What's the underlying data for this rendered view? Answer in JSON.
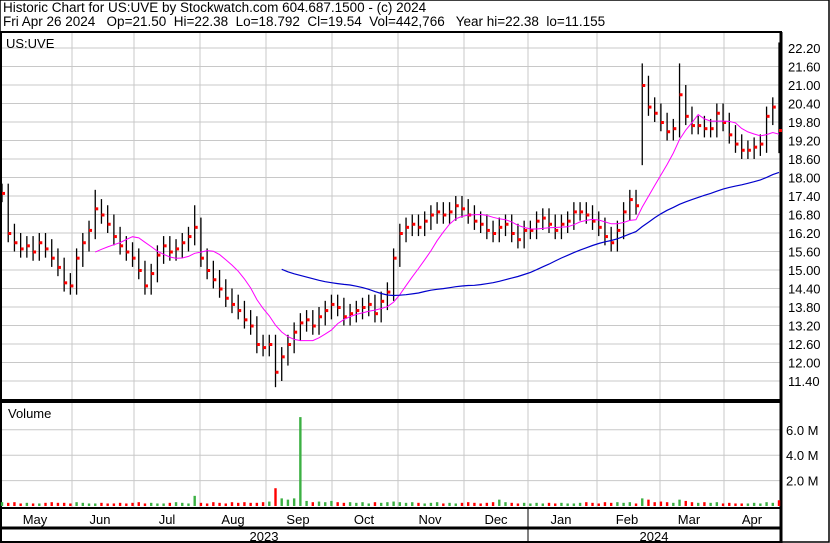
{
  "header": {
    "title": "Historic Chart for US:UVE by Stockwatch.com 604.687.1500 - (c) 2024",
    "quote": "Fri Apr 26 2024   Op=21.50  Hi=22.38  Lo=18.792  Cl=19.54  Vol=442,766   Year hi=22.38  lo=11.155"
  },
  "colors": {
    "up": "#3cb043",
    "down": "#ff0000",
    "bar": "#000000",
    "ma_short": "#ff00ff",
    "ma_long": "#0000cc",
    "grid": "#c8c8c8"
  },
  "chart_data": {
    "type": "line",
    "title": "US:UVE",
    "symbol_label": "US:UVE",
    "volume_label": "Volume",
    "price_ylim": [
      11.1,
      23.0
    ],
    "price_ticks": [
      "22.20",
      "21.60",
      "21.00",
      "20.40",
      "19.80",
      "19.20",
      "18.60",
      "18.00",
      "17.40",
      "16.80",
      "16.20",
      "15.60",
      "15.00",
      "14.40",
      "13.80",
      "13.20",
      "12.60",
      "12.00",
      "11.40"
    ],
    "volume_ticks": [
      {
        "v": 6,
        "label": "6.0 M"
      },
      {
        "v": 4,
        "label": "4.0 M"
      },
      {
        "v": 2,
        "label": "2.0 M"
      }
    ],
    "months": [
      "May",
      "Jun",
      "Jul",
      "Aug",
      "Sep",
      "Oct",
      "Nov",
      "Dec",
      "Jan",
      "Feb",
      "Mar",
      "Apr"
    ],
    "years": [
      "2023",
      "2024"
    ],
    "ma_short_period": 10,
    "ma_long_period": 45,
    "closes": [
      17.5,
      16.2,
      15.9,
      15.7,
      15.8,
      15.6,
      15.9,
      15.7,
      15.4,
      15.1,
      14.6,
      14.5,
      15.4,
      15.9,
      16.3,
      17.0,
      16.8,
      16.5,
      16.1,
      15.8,
      15.6,
      15.4,
      15.0,
      14.5,
      14.9,
      15.5,
      15.8,
      15.6,
      15.7,
      15.9,
      16.1,
      16.4,
      15.4,
      15.0,
      14.7,
      14.4,
      14.1,
      13.9,
      13.7,
      13.4,
      13.2,
      12.6,
      12.5,
      12.6,
      11.7,
      12.2,
      12.6,
      13.0,
      13.3,
      13.4,
      13.2,
      13.5,
      13.7,
      13.9,
      13.8,
      13.5,
      13.6,
      13.7,
      13.8,
      13.9,
      13.6,
      14.0,
      14.3,
      15.4,
      16.2,
      16.4,
      16.5,
      16.4,
      16.6,
      16.8,
      16.9,
      16.8,
      16.9,
      17.1,
      17.0,
      16.8,
      16.6,
      16.5,
      16.3,
      16.2,
      16.4,
      16.5,
      16.2,
      16.0,
      16.3,
      16.3,
      16.6,
      16.7,
      16.5,
      16.3,
      16.5,
      16.6,
      16.9,
      16.9,
      16.8,
      16.6,
      16.4,
      16.1,
      15.9,
      16.3,
      16.9,
      17.3,
      17.1,
      21.0,
      20.3,
      20.1,
      19.8,
      19.5,
      19.6,
      20.7,
      20.0,
      19.7,
      19.7,
      19.6,
      19.6,
      20.1,
      19.8,
      19.4,
      19.1,
      18.9,
      18.9,
      19.0,
      19.1,
      20.0,
      20.3,
      19.54
    ],
    "high_overrides": {
      "15": 17.6,
      "31": 17.1,
      "103": 21.7,
      "109": 21.7,
      "125": 22.38
    },
    "low_overrides": {
      "44": 11.2,
      "103": 18.4,
      "125": 18.79
    },
    "volumes_m": [
      0.3,
      0.25,
      0.3,
      0.2,
      0.25,
      0.2,
      0.2,
      0.25,
      0.3,
      0.25,
      0.25,
      0.2,
      0.3,
      0.25,
      0.2,
      0.2,
      0.25,
      0.2,
      0.2,
      0.25,
      0.2,
      0.25,
      0.3,
      0.2,
      0.25,
      0.2,
      0.2,
      0.25,
      0.3,
      0.25,
      0.2,
      0.8,
      0.25,
      0.2,
      0.3,
      0.25,
      0.2,
      0.3,
      0.25,
      0.3,
      0.25,
      0.25,
      0.3,
      0.35,
      1.4,
      0.6,
      0.5,
      0.6,
      7.0,
      0.4,
      0.3,
      0.35,
      0.3,
      0.4,
      0.3,
      0.25,
      0.3,
      0.25,
      0.3,
      0.2,
      0.3,
      0.25,
      0.3,
      0.35,
      0.3,
      0.25,
      0.3,
      0.25,
      0.2,
      0.25,
      0.3,
      0.2,
      0.25,
      0.2,
      0.25,
      0.3,
      0.25,
      0.2,
      0.25,
      0.3,
      0.5,
      0.3,
      0.25,
      0.2,
      0.25,
      0.2,
      0.25,
      0.2,
      0.25,
      0.2,
      0.25,
      0.2,
      0.2,
      0.25,
      0.3,
      0.25,
      0.2,
      0.3,
      0.25,
      0.3,
      0.25,
      0.3,
      0.2,
      0.6,
      0.5,
      0.3,
      0.35,
      0.3,
      0.25,
      0.5,
      0.4,
      0.3,
      0.25,
      0.3,
      0.25,
      0.3,
      0.2,
      0.25,
      0.2,
      0.2,
      0.2,
      0.25,
      0.2,
      0.3,
      0.25,
      0.45
    ]
  }
}
